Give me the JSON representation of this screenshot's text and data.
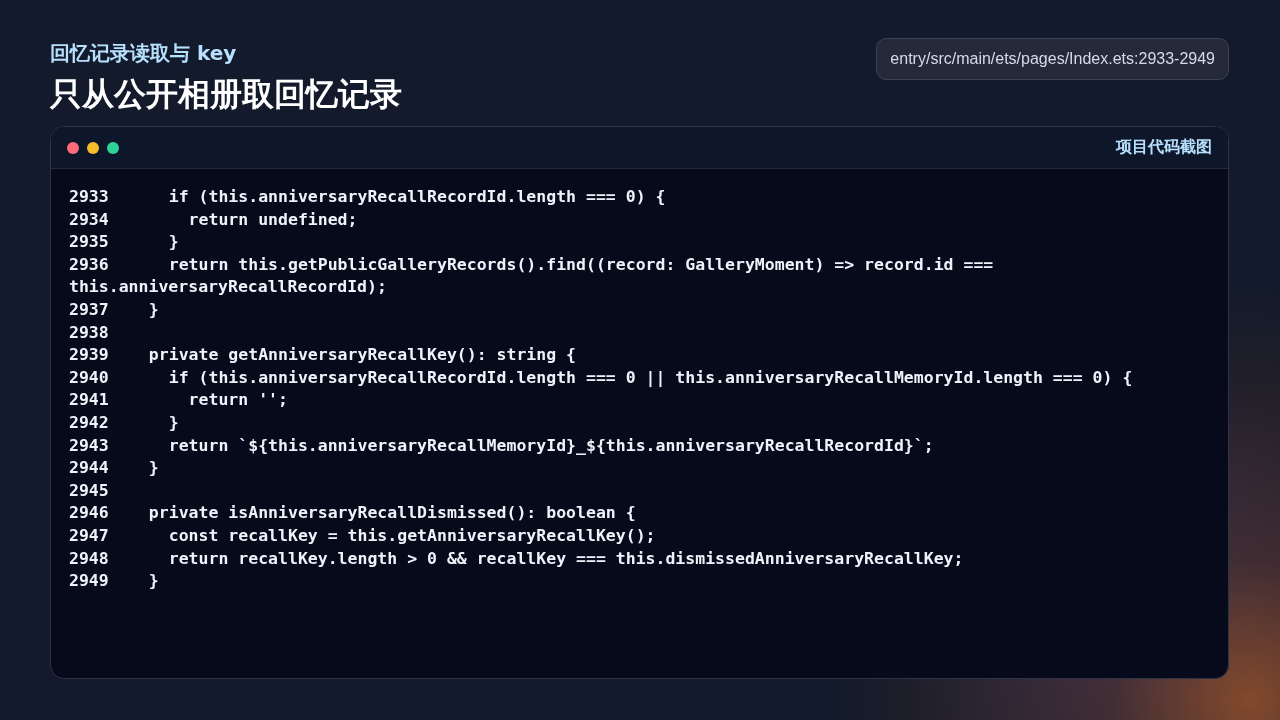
{
  "header": {
    "subtitle": "回忆记录读取与 key",
    "title": "只从公开相册取回忆记录",
    "file_path": "entry/src/main/ets/pages/Index.ets:2933-2949"
  },
  "code_window": {
    "label": "项目代码截图",
    "lines": [
      {
        "number": "2933",
        "code": "    if (this.anniversaryRecallRecordId.length === 0) {"
      },
      {
        "number": "2934",
        "code": "      return undefined;"
      },
      {
        "number": "2935",
        "code": "    }"
      },
      {
        "number": "2936",
        "code": "    return this.getPublicGalleryRecords().find((record: GalleryMoment) => record.id === this.anniversaryRecallRecordId);"
      },
      {
        "number": "2937",
        "code": "  }"
      },
      {
        "number": "2938"
      },
      {
        "number": "2939",
        "code": "  private getAnniversaryRecallKey(): string {"
      },
      {
        "number": "2940",
        "code": "    if (this.anniversaryRecallRecordId.length === 0 || this.anniversaryRecallMemoryId.length === 0) {"
      },
      {
        "number": "2941",
        "code": "      return '';"
      },
      {
        "number": "2942",
        "code": "    }"
      },
      {
        "number": "2943",
        "code": "    return `${this.anniversaryRecallMemoryId}_${this.anniversaryRecallRecordId}`;"
      },
      {
        "number": "2944",
        "code": "  }"
      },
      {
        "number": "2945"
      },
      {
        "number": "2946",
        "code": "  private isAnniversaryRecallDismissed(): boolean {"
      },
      {
        "number": "2947",
        "code": "    const recallKey = this.getAnniversaryRecallKey();"
      },
      {
        "number": "2948",
        "code": "    return recallKey.length > 0 && recallKey === this.dismissedAnniversaryRecallKey;"
      },
      {
        "number": "2949",
        "code": "  }"
      }
    ]
  }
}
